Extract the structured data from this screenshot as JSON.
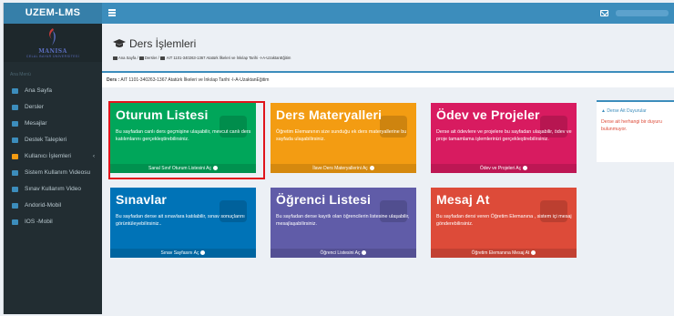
{
  "app": {
    "title": "UZEM-LMS"
  },
  "logo": {
    "line1": "MANISA",
    "line2": "CELAL BAYAR ÜNİVERSİTESİ"
  },
  "sidebar": {
    "header": "Ana Menü",
    "items": [
      {
        "label": "Ana Sayfa",
        "icon": "home-icon",
        "color": "#3c8dbc"
      },
      {
        "label": "Dersler",
        "icon": "book-icon",
        "color": "#3c8dbc"
      },
      {
        "label": "Mesajlar",
        "icon": "envelope-icon",
        "color": "#3c8dbc"
      },
      {
        "label": "Destek Talepleri",
        "icon": "support-icon",
        "color": "#3c8dbc"
      },
      {
        "label": "Kullanıcı İşlemleri",
        "icon": "user-icon",
        "color": "#f39c12",
        "arrow": "‹"
      },
      {
        "label": "Sistem Kullanım Videosu",
        "icon": "video-icon",
        "color": "#3c8dbc"
      },
      {
        "label": "Sınav Kullanım Video",
        "icon": "video-icon",
        "color": "#3c8dbc"
      },
      {
        "label": "Andorid-Mobil",
        "icon": "video-icon",
        "color": "#3c8dbc"
      },
      {
        "label": "IOS -Mobil",
        "icon": "video-icon",
        "color": "#3c8dbc"
      }
    ]
  },
  "page": {
    "title": "Ders İşlemleri",
    "breadcrumb": [
      "Ana Sayfa",
      "Dersler",
      "AIT 1101-340263-1367 Atatürk İlkeleri ve İnkılap Tarihi -I-A-UzaktanEğitim"
    ],
    "course_label": "Ders :",
    "course_name": "AIT 1101-340263-1367 Atatürk İlkeleri ve İnkılap Tarihi -I-A-UzaktanEğitim"
  },
  "tiles": [
    {
      "title": "Oturum Listesi",
      "desc": "Bu sayfadan canlı ders geçmişine ulaşabilir, mevcut canlı ders katılımlarını gerçekleştirebilirsiniz.",
      "footer": "Sanal Sınıf Oturum Listesini Aç",
      "color": "#00a65a"
    },
    {
      "title": "Ders Materyalleri",
      "desc": "Öğretim Elemanının size sunduğu ek ders materyallerine bu sayfada ulaşabilirsiniz.",
      "footer": "İlave Ders Materyallerini Aç",
      "color": "#f39c12"
    },
    {
      "title": "Ödev ve Projeler",
      "desc": "Derse ait ödevlere ve projelere bu sayfadan ulaşabilir, ödev ve proje tamamlama işlemlerinizi gerçekleştirebilirsiniz.",
      "footer": "Ödev ve Projeleri Aç",
      "color": "#d81b60"
    },
    {
      "title": "Sınavlar",
      "desc": "Bu sayfadan derse ait sınavlara katılabilir, sınav sonuçlarını görüntüleyebilirsiniz..",
      "footer": "Sınav Sayfasını Aç",
      "color": "#0073b7"
    },
    {
      "title": "Öğrenci Listesi",
      "desc": "Bu sayfadan derse kayıtlı olan öğrencilerin listesine ulaşabilir, mesajlaşabilirsiniz.",
      "footer": "Öğrenci Listesini Aç",
      "color": "#605ca8"
    },
    {
      "title": "Mesaj At",
      "desc": "Bu sayfadan dersi veren Öğretim Elemanına , sistem içi mesaj gönderebilirsiniz.",
      "footer": "Öğretim Elemanına Mesaj At",
      "color": "#dd4b39"
    }
  ],
  "announcements": {
    "title": "Derse Ait Duyurular",
    "body": "Derse ait herhangi bir duyuru bulunmuyor."
  }
}
